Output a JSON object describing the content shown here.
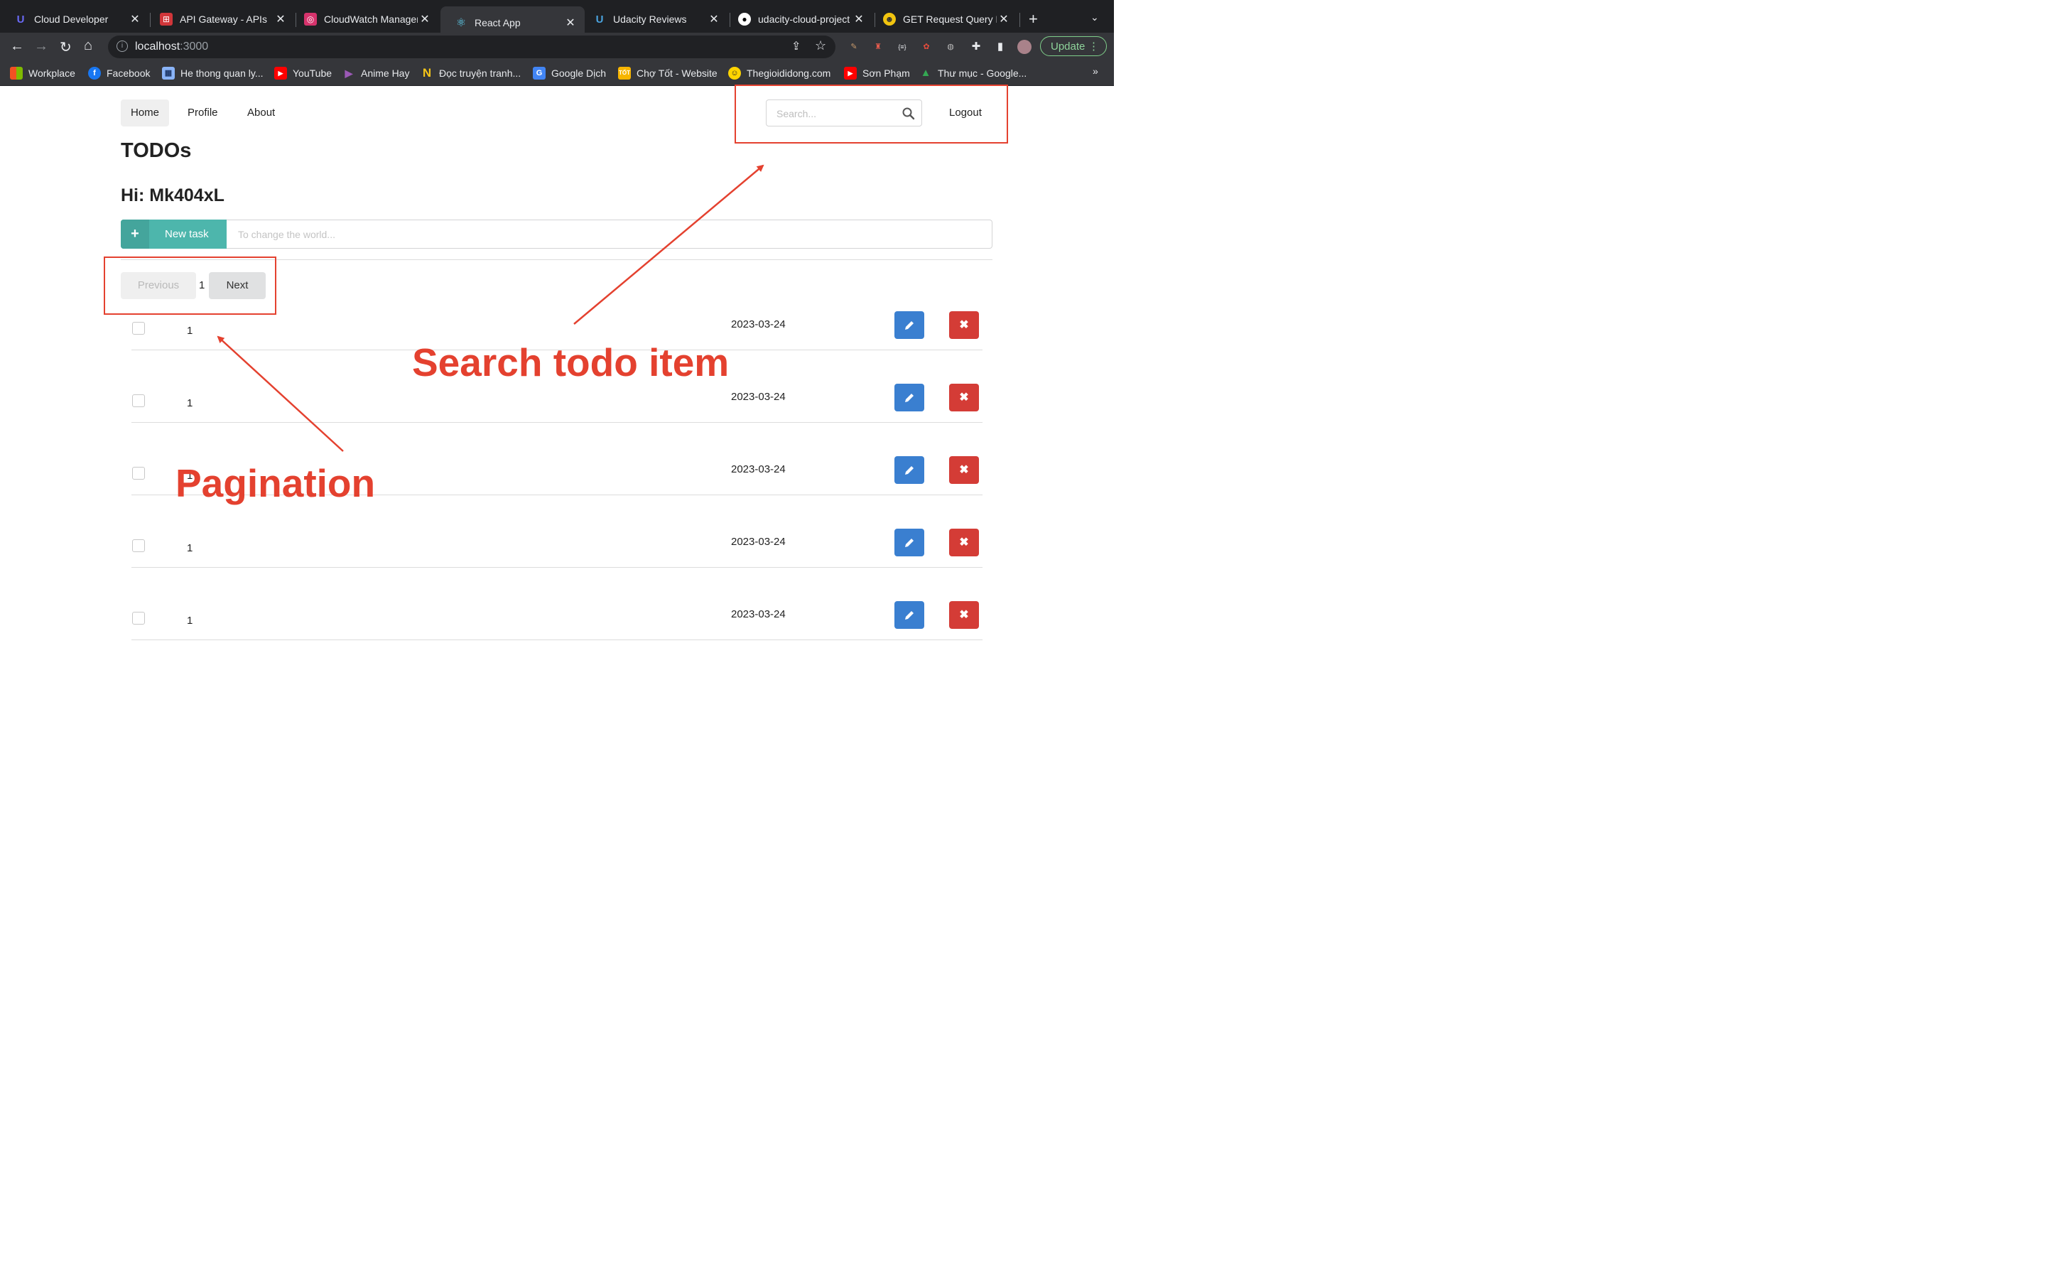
{
  "browser": {
    "tabs": [
      {
        "title": "Cloud Developer",
        "icon": "udacity-icon",
        "color": "#5b5bf5"
      },
      {
        "title": "API Gateway - APIs",
        "icon": "api-gateway-icon",
        "color": "#d1363a"
      },
      {
        "title": "CloudWatch Managem",
        "icon": "cloudwatch-icon",
        "color": "#d6336c"
      },
      {
        "title": "React App",
        "icon": "react-icon",
        "color": "#61dafb",
        "active": true
      },
      {
        "title": "Udacity Reviews",
        "icon": "udacity-icon",
        "color": "#4aa3df"
      },
      {
        "title": "udacity-cloud-project",
        "icon": "github-icon",
        "color": "#ffffff"
      },
      {
        "title": "GET Request Query P",
        "icon": "emoji-icon",
        "color": "#f1c40f"
      }
    ],
    "url_host": "localhost",
    "url_port": ":3000",
    "update_label": "Update",
    "bookmarks": [
      {
        "label": "Workplace",
        "icon": "workplace-icon"
      },
      {
        "label": "Facebook",
        "icon": "facebook-icon"
      },
      {
        "label": "He thong quan ly...",
        "icon": "grid-icon"
      },
      {
        "label": "YouTube",
        "icon": "youtube-icon"
      },
      {
        "label": "Anime Hay",
        "icon": "play-icon"
      },
      {
        "label": "Đọc truyện tranh...",
        "icon": "n-icon"
      },
      {
        "label": "Google Dịch",
        "icon": "translate-icon"
      },
      {
        "label": "Chợ Tốt - Website",
        "icon": "chotot-icon"
      },
      {
        "label": "Thegioididong.com",
        "icon": "tgdd-icon"
      },
      {
        "label": "Sơn Phạm",
        "icon": "youtube-icon"
      },
      {
        "label": "Thư mục - Google...",
        "icon": "drive-icon"
      }
    ],
    "bookmarks_more": "»"
  },
  "app": {
    "nav": {
      "home": "Home",
      "profile": "Profile",
      "about": "About",
      "logout": "Logout"
    },
    "search": {
      "placeholder": "Search..."
    },
    "title": "TODOs",
    "greeting": "Hi: Mk404xL",
    "new_task": {
      "label": "New task",
      "placeholder": "To change the world..."
    },
    "pagination": {
      "previous": "Previous",
      "page": "1",
      "next": "Next"
    },
    "todos": [
      {
        "name": "1",
        "date": "2023-03-24",
        "done": false
      },
      {
        "name": "1",
        "date": "2023-03-24",
        "done": false
      },
      {
        "name": "1",
        "date": "2023-03-24",
        "done": false
      },
      {
        "name": "1",
        "date": "2023-03-24",
        "done": false
      },
      {
        "name": "1",
        "date": "2023-03-24",
        "done": false
      }
    ],
    "colors": {
      "teal": "#4db6ac",
      "blue": "#3a7fd0",
      "red": "#d43c36"
    }
  },
  "annotations": {
    "search_label": "Search todo item",
    "pagination_label": "Pagination",
    "color": "#e4412f"
  }
}
